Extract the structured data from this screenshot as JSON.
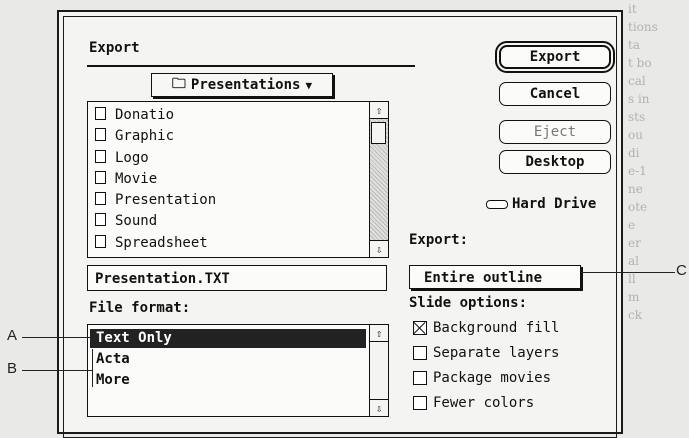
{
  "background_text": [
    "it",
    "tions",
    "ta",
    "t bo",
    "cal",
    "s in",
    "sts",
    "ou",
    "di",
    "e-1",
    "ne",
    "ote",
    "e",
    "er",
    "al",
    "ll",
    "m",
    "ck"
  ],
  "dialog": {
    "title": "Export",
    "folder_popup": "Presentations",
    "files": [
      "Donatio",
      "Graphic",
      "Logo",
      "Movie",
      "Presentation",
      "Sound",
      "Spreadsheet"
    ],
    "filename_value": "Presentation.TXT",
    "file_format_label": "File format:",
    "formats": [
      {
        "label": "Text Only",
        "selected": true
      },
      {
        "label": "Acta",
        "selected": false
      },
      {
        "label": "More",
        "selected": false
      }
    ],
    "buttons": {
      "export": "Export",
      "cancel": "Cancel",
      "eject": "Eject",
      "desktop": "Desktop"
    },
    "drive_label": "Hard Drive",
    "export_label": "Export:",
    "export_scope": "Entire outline",
    "slide_options_label": "Slide options:",
    "slide_options": [
      {
        "label": "Background fill",
        "checked": true
      },
      {
        "label": "Separate layers",
        "checked": false
      },
      {
        "label": "Package movies",
        "checked": false
      },
      {
        "label": "Fewer colors",
        "checked": false
      }
    ]
  },
  "callouts": {
    "a": "A",
    "b": "B",
    "c": "C"
  }
}
